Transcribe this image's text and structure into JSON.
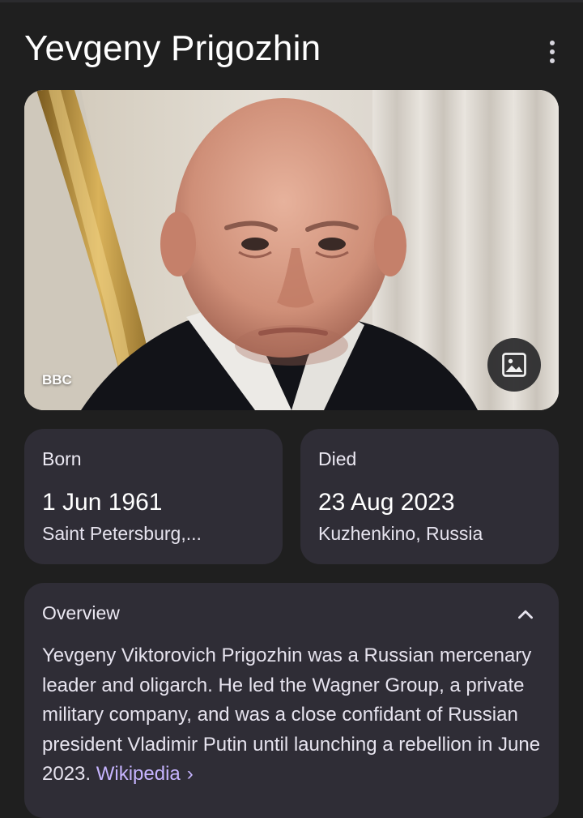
{
  "header": {
    "title": "Yevgeny Prigozhin",
    "more_icon": "more-vert-icon"
  },
  "hero": {
    "source": "BBC",
    "image_icon": "image-icon"
  },
  "facts": {
    "born": {
      "label": "Born",
      "date": "1 Jun 1961",
      "place": "Saint Petersburg,..."
    },
    "died": {
      "label": "Died",
      "date": "23 Aug 2023",
      "place": "Kuzhenkino, Russia"
    }
  },
  "overview": {
    "heading": "Overview",
    "collapse_icon": "chevron-up-icon",
    "text": "Yevgeny Viktorovich Prigozhin was a Russian mercenary leader and oligarch. He led the Wagner Group, a private military company, and was a close confidant of Russian president Vladimir Putin until launching a rebellion in June 2023.",
    "link_label": "Wikipedia",
    "link_chevron": "›"
  },
  "colors": {
    "background": "#1f1f1f",
    "card": "#2f2d36",
    "link": "#c6b4ff",
    "text": "#e6e3ee"
  }
}
